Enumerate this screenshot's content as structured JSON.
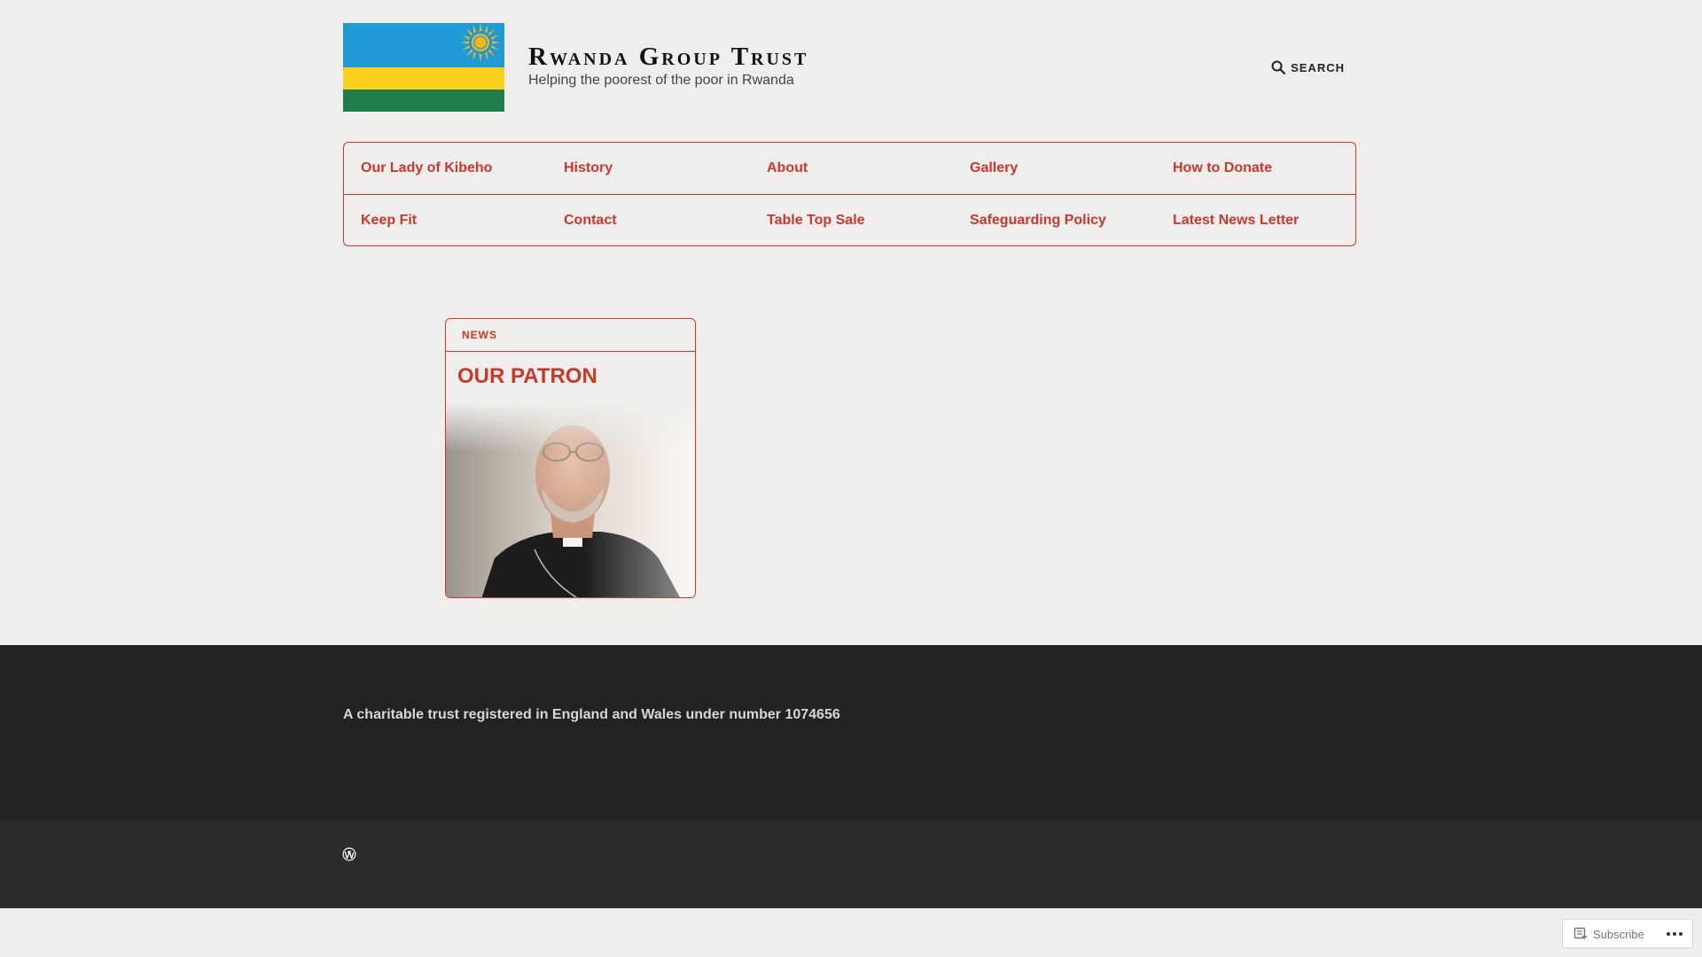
{
  "site": {
    "title": "Rwanda Group Trust",
    "tagline": "Helping the poorest of the poor in Rwanda",
    "flag_colors": {
      "blue": "#1f9ad6",
      "yellow": "#fad01c",
      "green": "#1e7d4a",
      "sun": "#f2b81b"
    }
  },
  "header": {
    "search_label": "SEARCH",
    "search_icon": "search-icon"
  },
  "nav": {
    "items": [
      {
        "label": "Our Lady of Kibeho"
      },
      {
        "label": "History"
      },
      {
        "label": "About"
      },
      {
        "label": "Gallery"
      },
      {
        "label": "How to Donate"
      },
      {
        "label": "Keep Fit"
      },
      {
        "label": "Contact"
      },
      {
        "label": "Table Top Sale"
      },
      {
        "label": "Safeguarding Policy"
      },
      {
        "label": "Latest News Letter"
      }
    ]
  },
  "posts": [
    {
      "category": "NEWS",
      "title": "OUR PATRON",
      "image": "portrait-photo"
    }
  ],
  "footer": {
    "charity_text": "A charitable trust registered in England and Wales under number 1074656",
    "wordpress_icon": "wordpress-icon"
  },
  "subscribe_bar": {
    "subscribe_label": "Subscribe",
    "more_icon": "ellipsis-icon"
  },
  "colors": {
    "accent": "#c8382c",
    "background": "#efeeec",
    "footer_dark": "#222222",
    "footer_bottom": "#2b2b2b"
  }
}
